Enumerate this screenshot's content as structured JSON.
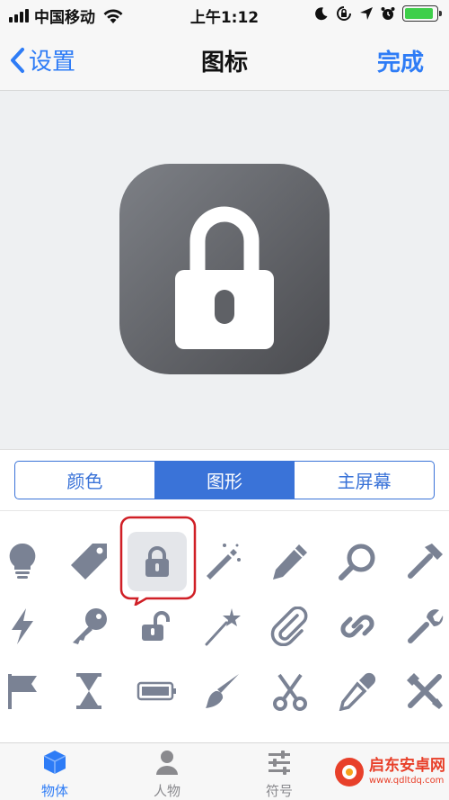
{
  "status_bar": {
    "carrier": "中国移动",
    "time": "上午1:12",
    "battery_level": 0.9
  },
  "nav": {
    "back_label": "设置",
    "title": "图标",
    "done_label": "完成"
  },
  "preview": {
    "icon_name": "lock-icon",
    "gradient": [
      "#7d8086",
      "#4b4c50"
    ]
  },
  "segments": [
    {
      "label": "颜色",
      "active": false
    },
    {
      "label": "图形",
      "active": true
    },
    {
      "label": "主屏幕",
      "active": false
    }
  ],
  "icon_grid": {
    "selected": "lock-icon",
    "rows": [
      [
        "lightbulb-icon",
        "tag-icon",
        "lock-icon",
        "magic-wand-icon",
        "pencil-icon",
        "magnifier-icon",
        "hammer-icon"
      ],
      [
        "lightning-icon",
        "key-icon",
        "unlock-icon",
        "wand-star-icon",
        "paperclip-icon",
        "link-icon",
        "wrench-icon"
      ],
      [
        "flag-icon",
        "hourglass-icon",
        "battery-icon",
        "paintbrush-icon",
        "scissors-icon",
        "eyedropper-icon",
        "tools-icon"
      ]
    ]
  },
  "tabs": [
    {
      "label": "物体",
      "icon": "cube-icon",
      "active": true
    },
    {
      "label": "人物",
      "icon": "person-icon",
      "active": false
    },
    {
      "label": "符号",
      "icon": "sliders-icon",
      "active": false
    }
  ],
  "watermark": {
    "main": "启东安卓网",
    "sub": "www.qdltdq.com"
  },
  "colors": {
    "accent": "#2e7cf6",
    "segment": "#3a73d8",
    "icon": "#7a8294",
    "highlight": "#d01f26"
  }
}
